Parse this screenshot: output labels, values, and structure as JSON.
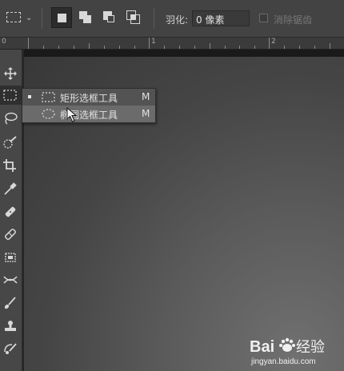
{
  "options_bar": {
    "feather_label": "羽化:",
    "feather_value": "0 像素",
    "antialias_label": "消除锯齿"
  },
  "ruler": {
    "zero": "0",
    "one": "1",
    "two": "2"
  },
  "flyout": {
    "items": [
      {
        "label": "矩形选框工具",
        "shortcut": "M",
        "selected": true
      },
      {
        "label": "椭圆选框工具",
        "shortcut": "M",
        "selected": false
      }
    ]
  },
  "watermark": {
    "text": "Bai",
    "text2": "经验",
    "url": "jingyan.baidu.com"
  },
  "colors": {
    "accent_active": "#2c2c2c",
    "flyout_hover": "#6b6b6b"
  }
}
